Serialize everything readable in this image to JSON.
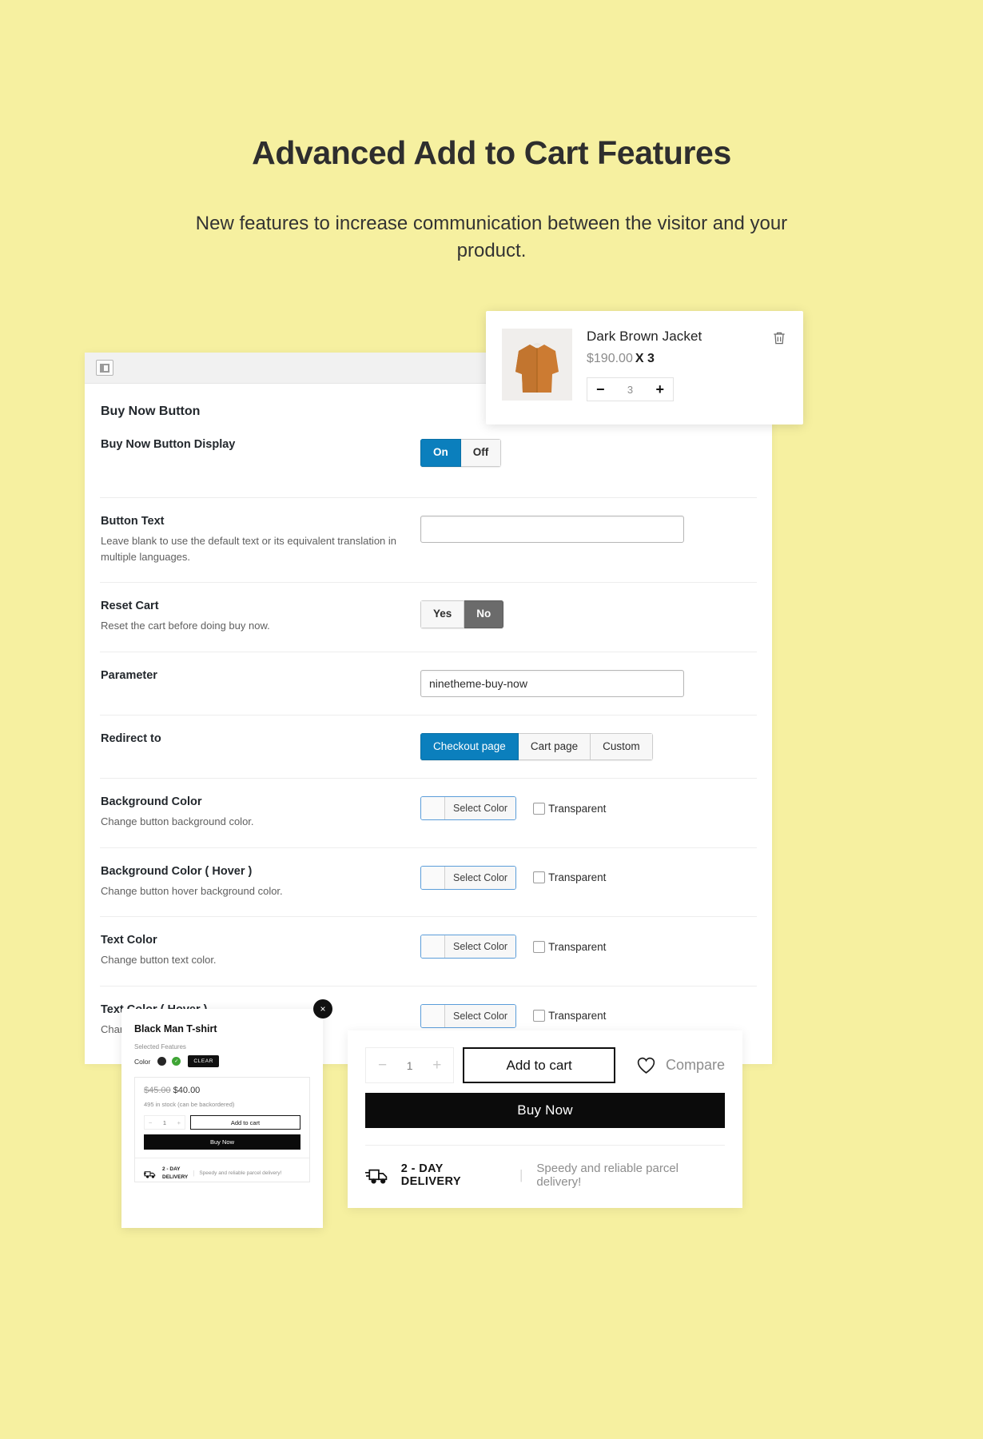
{
  "hero": {
    "title": "Advanced Add to Cart Features",
    "subtitle": "New features to increase communication between the visitor and your product."
  },
  "cart_popup": {
    "product_title": "Dark Brown Jacket",
    "price": "$190.00",
    "multiplier": "X 3",
    "qty_value": "3",
    "minus": "−",
    "plus": "+",
    "delete_icon": "trash-icon"
  },
  "admin": {
    "section_title": "Buy Now Button",
    "rows": [
      {
        "label": "Buy Now Button Display",
        "desc": "",
        "control": "toggle",
        "options": [
          "On",
          "Off"
        ],
        "active": 0,
        "active_style": "blue"
      },
      {
        "label": "Button Text",
        "desc": "Leave blank to use the default text or its equivalent translation in multiple languages.",
        "control": "input",
        "value": "",
        "placeholder": ""
      },
      {
        "label": "Reset Cart",
        "desc": "Reset the cart before doing buy now.",
        "control": "toggle",
        "options": [
          "Yes",
          "No"
        ],
        "active": 1,
        "active_style": "gray"
      },
      {
        "label": "Parameter",
        "desc": "",
        "control": "input",
        "value": "ninetheme-buy-now",
        "placeholder": ""
      },
      {
        "label": "Redirect to",
        "desc": "",
        "control": "toggle",
        "options": [
          "Checkout page",
          "Cart page",
          "Custom"
        ],
        "active": 0,
        "active_style": "blue"
      },
      {
        "label": "Background Color",
        "desc": "Change button background color.",
        "control": "color",
        "button_label": "Select Color",
        "checkbox_label": "Transparent"
      },
      {
        "label": "Background Color ( Hover )",
        "desc": "Change button hover background color.",
        "control": "color",
        "button_label": "Select Color",
        "checkbox_label": "Transparent"
      },
      {
        "label": "Text Color",
        "desc": "Change button text color.",
        "control": "color",
        "button_label": "Select Color",
        "checkbox_label": "Transparent"
      },
      {
        "label": "Text Color ( Hover )",
        "desc": "Change button hover text color.",
        "control": "color",
        "button_label": "Select Color",
        "checkbox_label": "Transparent"
      }
    ]
  },
  "tshirt_card": {
    "close_label": "×",
    "title": "Black Man T-shirt",
    "features_label": "Selected Features",
    "color_label": "Color",
    "clear_label": "CLEAR",
    "old_price": "$45.00",
    "new_price": "$40.00",
    "stock": "495 in stock (can be backordered)",
    "qty_value": "1",
    "minus": "−",
    "plus": "+",
    "add_to_cart": "Add to cart",
    "buy_now": "Buy Now",
    "delivery_line1": "2 - DAY",
    "delivery_line2": "DELIVERY",
    "delivery_desc": "Speedy and reliable parcel delivery!"
  },
  "buy_card": {
    "qty_value": "1",
    "minus": "−",
    "plus": "+",
    "add_to_cart": "Add to cart",
    "compare": "Compare",
    "buy_now": "Buy Now",
    "delivery_label": "2 - DAY DELIVERY",
    "delivery_desc": "Speedy and reliable parcel delivery!"
  },
  "colors": {
    "background": "#f6f0a0",
    "accent_blue": "#0b7fbd",
    "accent_gray": "#6b6b6b",
    "black": "#0b0b0b"
  }
}
